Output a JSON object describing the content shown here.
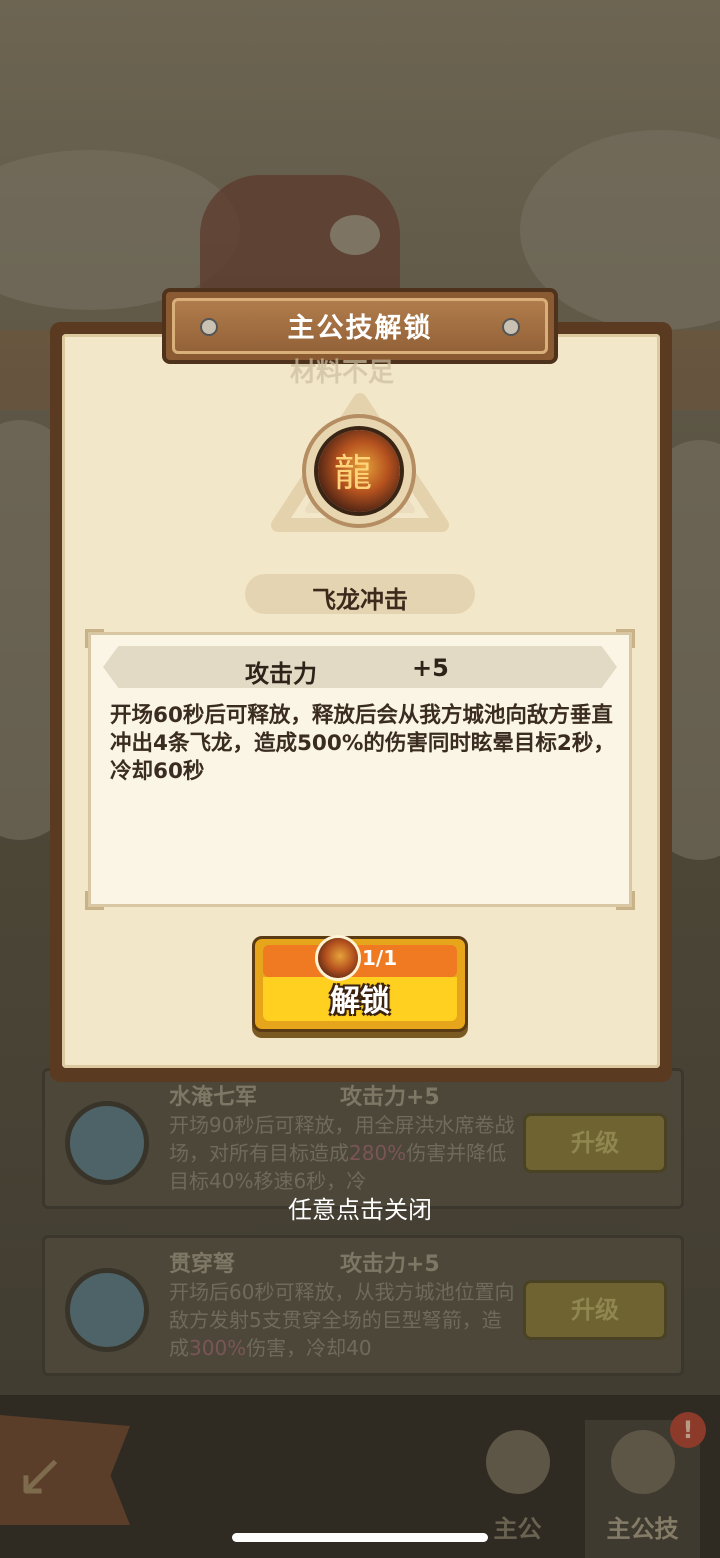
{
  "popup": {
    "title": "主公技解锁",
    "faded_text": "材料不足",
    "skill_name": "飞龙冲击",
    "stat_label": "攻击力",
    "stat_value": "+5",
    "description": "开场60秒后可释放，释放后会从我方城池向敌方垂直冲出4条飞龙，造成500%的伤害同时眩晕目标2秒，冷却60秒",
    "cost": "1/1",
    "unlock_label": "解锁",
    "icon": "dragon-icon"
  },
  "close_hint": "任意点击关闭",
  "background_cards": [
    {
      "name": "水淹七军",
      "attack": "攻击力+5",
      "desc_pre": "开场90秒后可释放，用全屏洪水席卷战场，对所有目标造成",
      "desc_pct": "280%",
      "desc_post": "伤害并降低目标40%移速6秒，冷",
      "button": "升级",
      "icon": "wave-icon"
    },
    {
      "name": "贯穿弩",
      "attack": "攻击力+5",
      "desc_pre": "开场后60秒可释放，从我方城池位置向敌方发射5支贯穿全场的巨型弩箭，造成",
      "desc_pct": "300%",
      "desc_post": "伤害，冷却40",
      "button": "升级",
      "icon": "arrow-icon"
    }
  ],
  "nav": {
    "tabs": [
      {
        "label": "主公",
        "icon": "fan-icon"
      },
      {
        "label": "主公技",
        "icon": "bag-icon"
      }
    ],
    "badge": "!"
  },
  "colors": {
    "popup_frame": "#5a3b22",
    "parchment": "#f3e7c9",
    "button_yellow": "#ffd020",
    "button_orange": "#f07a22"
  }
}
